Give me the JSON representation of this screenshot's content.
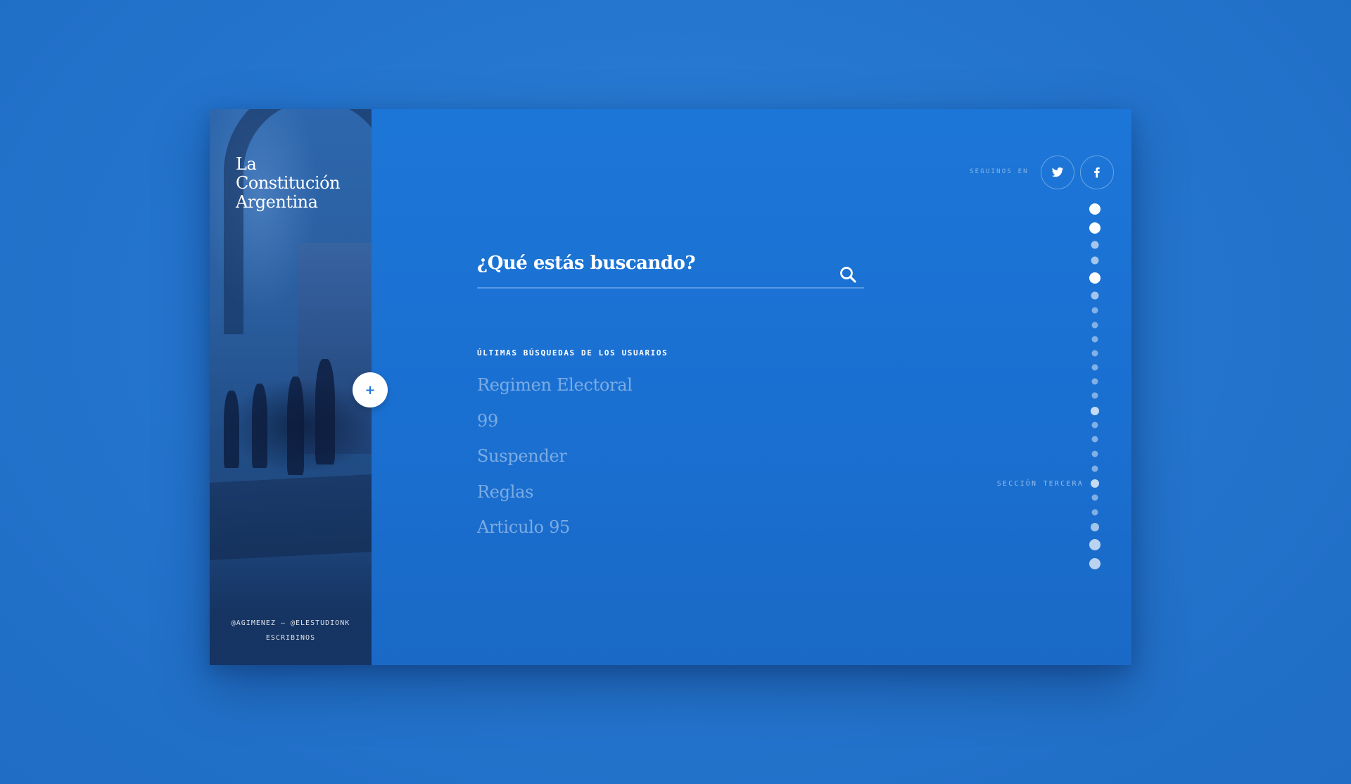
{
  "brand": {
    "title_lines": [
      "La",
      "Constitución",
      "Argentina"
    ]
  },
  "credits": {
    "line1": "@AGIMENEZ — @ELESTUDIONK",
    "line2": "ESCRIBINOS"
  },
  "sidebar_toggle": {
    "label": "+"
  },
  "search": {
    "placeholder": "¿Qué estás buscando?",
    "icon": "search-icon"
  },
  "recent": {
    "heading": "ÚLTIMAS BÚSQUEDAS DE LOS USUARIOS",
    "items": [
      "Regimen Electoral",
      "99",
      "Suspender",
      "Reglas",
      "Articulo 95"
    ]
  },
  "social": {
    "label": "SEGUINOS EN",
    "buttons": [
      {
        "name": "twitter",
        "icon": "twitter-icon"
      },
      {
        "name": "facebook",
        "icon": "facebook-icon"
      }
    ]
  },
  "section_nav": {
    "active_label": "SECCIÓN TERCERA"
  },
  "colors": {
    "background": "#2577cf",
    "panel": "#1c76d8",
    "text": "#ffffff",
    "muted_text": "#b9d2f0"
  }
}
